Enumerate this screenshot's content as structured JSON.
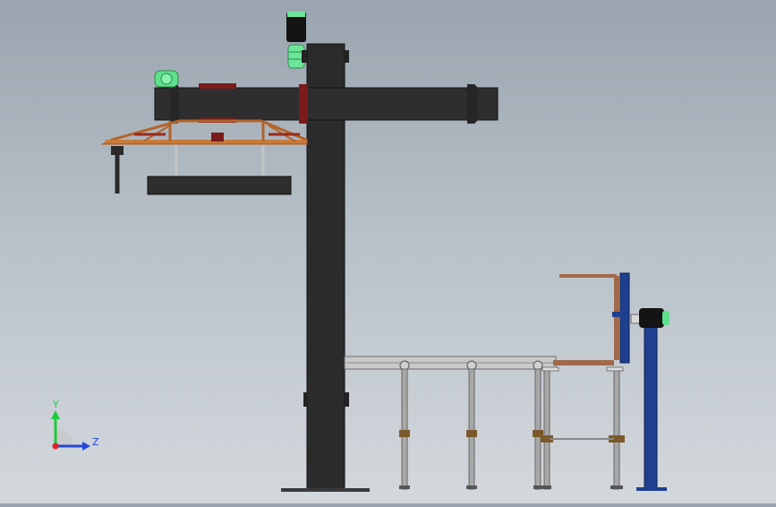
{
  "view": {
    "background_top": "#9aa4ae",
    "background_bottom": "#d3d8dc"
  },
  "triad": {
    "y_label": "Y",
    "z_label": "Z",
    "y_color": "#1ecb3c",
    "z_color": "#2745d6",
    "origin_color": "#e02020"
  },
  "colors": {
    "column": "#2b2b2b",
    "beam": "#2e2e2e",
    "truss": "#b4642a",
    "motor_green": "#5fe08a",
    "flange_red": "#7a1a1a",
    "rail_light": "#c9c9c9",
    "leg_gray": "#a8a8a8",
    "clamp_brown": "#7a5a2a",
    "blue_stand": "#1f3f8f",
    "copper_rod": "#a06a4a"
  }
}
